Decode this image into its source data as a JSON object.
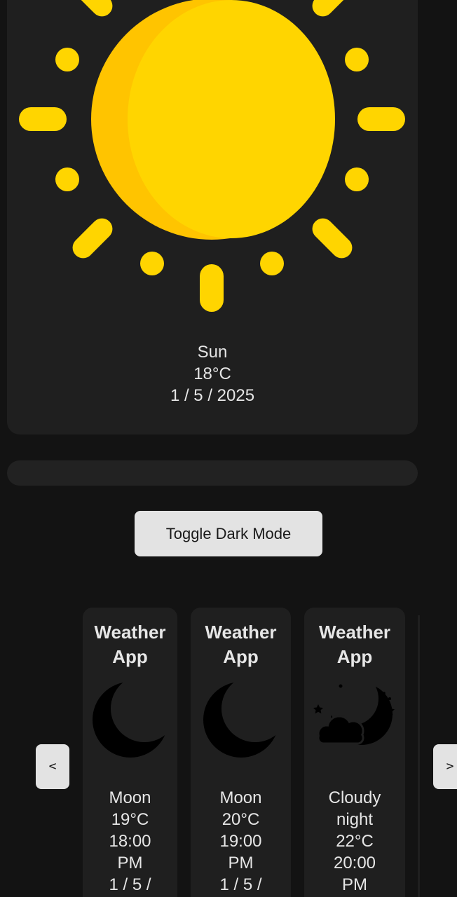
{
  "main": {
    "condition": "Sun",
    "temperature": "18°C",
    "date": "1 / 5 / 2025",
    "icon": "sun-icon",
    "sun_color": "#FFD500",
    "sun_shade_color": "#FFC400"
  },
  "progress": {
    "value": 0
  },
  "toggle": {
    "label": "Toggle Dark Mode"
  },
  "carousel": {
    "prev_label": "<",
    "next_label": ">",
    "cards": [
      {
        "title_line1": "Weather",
        "title_line2": "App",
        "icon": "moon-icon",
        "info": [
          "Moon",
          "19°C",
          "18:00",
          "PM",
          "1 / 5 /"
        ]
      },
      {
        "title_line1": "Weather",
        "title_line2": "App",
        "icon": "moon-icon",
        "info": [
          "Moon",
          "20°C",
          "19:00",
          "PM",
          "1 / 5 /"
        ]
      },
      {
        "title_line1": "Weather",
        "title_line2": "App",
        "icon": "cloudy-night-icon",
        "info": [
          "Cloudy",
          "night",
          "22°C",
          "20:00",
          "PM"
        ]
      }
    ]
  },
  "colors": {
    "background": "#131313",
    "card": "#1f1f1f",
    "text": "#e6e6e6",
    "button": "#e3e3e3"
  }
}
